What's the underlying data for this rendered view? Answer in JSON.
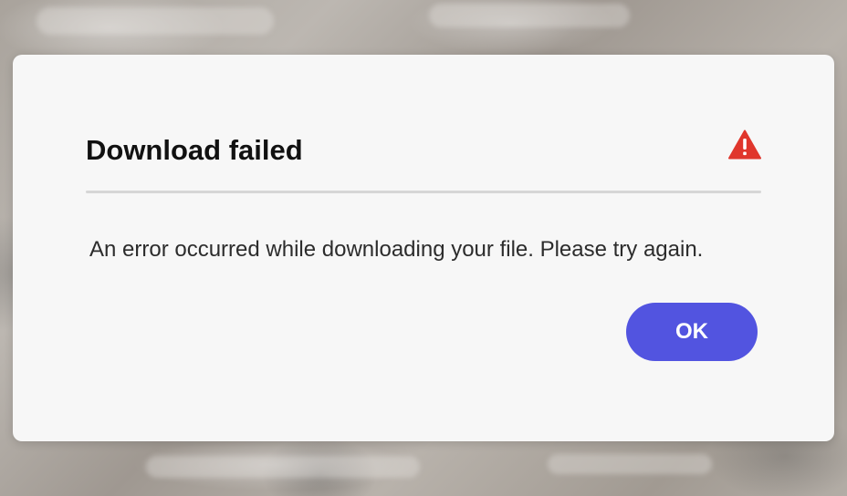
{
  "dialog": {
    "title": "Download failed",
    "message": "An error occurred while downloading your file. Please try again.",
    "ok_label": "OK",
    "alert_icon": "alert-triangle-icon"
  },
  "colors": {
    "accent": "#5254e0",
    "alert": "#e0362c",
    "dialog_background": "#f7f7f7",
    "title_text": "#111111",
    "body_text": "#2c2c2c",
    "divider": "#d6d6d6"
  }
}
